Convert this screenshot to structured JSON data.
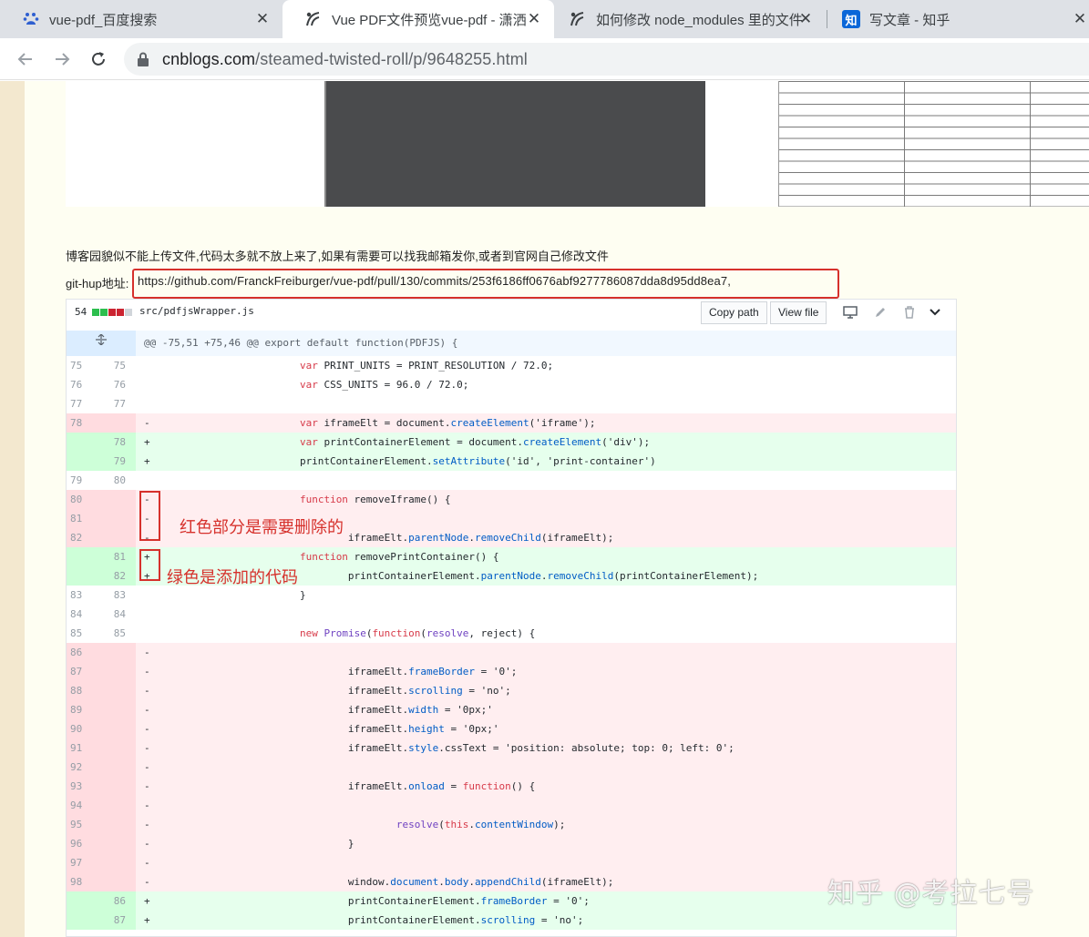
{
  "tabs": [
    {
      "title": "vue-pdf_百度搜索",
      "favicon": "baidu-paw-icon",
      "active": false
    },
    {
      "title": "Vue PDF文件预览vue-pdf - 潇洒",
      "favicon": "cnblogs-icon",
      "active": true
    },
    {
      "title": "如何修改 node_modules 里的文件",
      "favicon": "cnblogs-icon",
      "active": false
    },
    {
      "title": "写文章 - 知乎",
      "favicon": "zhihu-icon",
      "favicon_text": "知",
      "active": false
    }
  ],
  "tab_close_glyph": "✕",
  "address": {
    "host": "cnblogs.com",
    "path": "/steamed-twisted-roll/p/9648255.html"
  },
  "article": {
    "description": "博客园貌似不能上传文件,代码太多就不放上来了,如果有需要可以找我邮箱发你,或者到官网自己修改文件",
    "git_label": "git-hup地址:",
    "git_url": "https://github.com/FranckFreiburger/vue-pdf/pull/130/commits/253f6186ff0676abf9277786087dda8d95dd8ea7,"
  },
  "diff": {
    "changes_count": "54",
    "file_path": "src/pdfjsWrapper.js",
    "copy_path_label": "Copy path",
    "view_file_label": "View file",
    "hunk_header": "@@ -75,51 +75,46 @@ export default function(PDFJS) {",
    "expand_icon": "unfold-icon",
    "colors": {
      "deletion": "#ffeef0",
      "addition": "#e6ffed",
      "hunk": "#f1f8ff"
    },
    "lines": [
      {
        "type": "ctx",
        "old": "75",
        "new": "75",
        "marker": "",
        "code": "                        var PRINT_UNITS = PRINT_RESOLUTION / 72.0;"
      },
      {
        "type": "ctx",
        "old": "76",
        "new": "76",
        "marker": "",
        "code": "                        var CSS_UNITS = 96.0 / 72.0;"
      },
      {
        "type": "ctx",
        "old": "77",
        "new": "77",
        "marker": "",
        "code": ""
      },
      {
        "type": "del",
        "old": "78",
        "new": "",
        "marker": "-",
        "code": "                        var iframeElt = document.createElement('iframe');"
      },
      {
        "type": "add",
        "old": "",
        "new": "78",
        "marker": "+",
        "code": "                        var printContainerElement = document.createElement('div');"
      },
      {
        "type": "add",
        "old": "",
        "new": "79",
        "marker": "+",
        "code": "                        printContainerElement.setAttribute('id', 'print-container')"
      },
      {
        "type": "ctx",
        "old": "79",
        "new": "80",
        "marker": "",
        "code": ""
      },
      {
        "type": "del",
        "old": "80",
        "new": "",
        "marker": "-",
        "code": "                        function removeIframe() {"
      },
      {
        "type": "del",
        "old": "81",
        "new": "",
        "marker": "-",
        "code": ""
      },
      {
        "type": "del",
        "old": "82",
        "new": "",
        "marker": "-",
        "code": "                                iframeElt.parentNode.removeChild(iframeElt);"
      },
      {
        "type": "add",
        "old": "",
        "new": "81",
        "marker": "+",
        "code": "                        function removePrintContainer() {"
      },
      {
        "type": "add",
        "old": "",
        "new": "82",
        "marker": "+",
        "code": "                                printContainerElement.parentNode.removeChild(printContainerElement);"
      },
      {
        "type": "ctx",
        "old": "83",
        "new": "83",
        "marker": "",
        "code": "                        }"
      },
      {
        "type": "ctx",
        "old": "84",
        "new": "84",
        "marker": "",
        "code": ""
      },
      {
        "type": "ctx",
        "old": "85",
        "new": "85",
        "marker": "",
        "code": "                        new Promise(function(resolve, reject) {"
      },
      {
        "type": "del",
        "old": "86",
        "new": "",
        "marker": "-",
        "code": ""
      },
      {
        "type": "del",
        "old": "87",
        "new": "",
        "marker": "-",
        "code": "                                iframeElt.frameBorder = '0';"
      },
      {
        "type": "del",
        "old": "88",
        "new": "",
        "marker": "-",
        "code": "                                iframeElt.scrolling = 'no';"
      },
      {
        "type": "del",
        "old": "89",
        "new": "",
        "marker": "-",
        "code": "                                iframeElt.width = '0px;'"
      },
      {
        "type": "del",
        "old": "90",
        "new": "",
        "marker": "-",
        "code": "                                iframeElt.height = '0px;'"
      },
      {
        "type": "del",
        "old": "91",
        "new": "",
        "marker": "-",
        "code": "                                iframeElt.style.cssText = 'position: absolute; top: 0; left: 0';"
      },
      {
        "type": "del",
        "old": "92",
        "new": "",
        "marker": "-",
        "code": ""
      },
      {
        "type": "del",
        "old": "93",
        "new": "",
        "marker": "-",
        "code": "                                iframeElt.onload = function() {"
      },
      {
        "type": "del",
        "old": "94",
        "new": "",
        "marker": "-",
        "code": ""
      },
      {
        "type": "del",
        "old": "95",
        "new": "",
        "marker": "-",
        "code": "                                        resolve(this.contentWindow);"
      },
      {
        "type": "del",
        "old": "96",
        "new": "",
        "marker": "-",
        "code": "                                }"
      },
      {
        "type": "del",
        "old": "97",
        "new": "",
        "marker": "-",
        "code": ""
      },
      {
        "type": "del",
        "old": "98",
        "new": "",
        "marker": "-",
        "code": "                                window.document.body.appendChild(iframeElt);"
      },
      {
        "type": "add",
        "old": "",
        "new": "86",
        "marker": "+",
        "code": "                                printContainerElement.frameBorder = '0';"
      },
      {
        "type": "add",
        "old": "",
        "new": "87",
        "marker": "+",
        "code": "                                printContainerElement.scrolling = 'no';"
      }
    ]
  },
  "annotations": {
    "red_note": "红色部分是需要删除的",
    "green_note": "绿色是添加的代码",
    "color": "#d6312c"
  },
  "watermark": "知乎 @考拉七号"
}
